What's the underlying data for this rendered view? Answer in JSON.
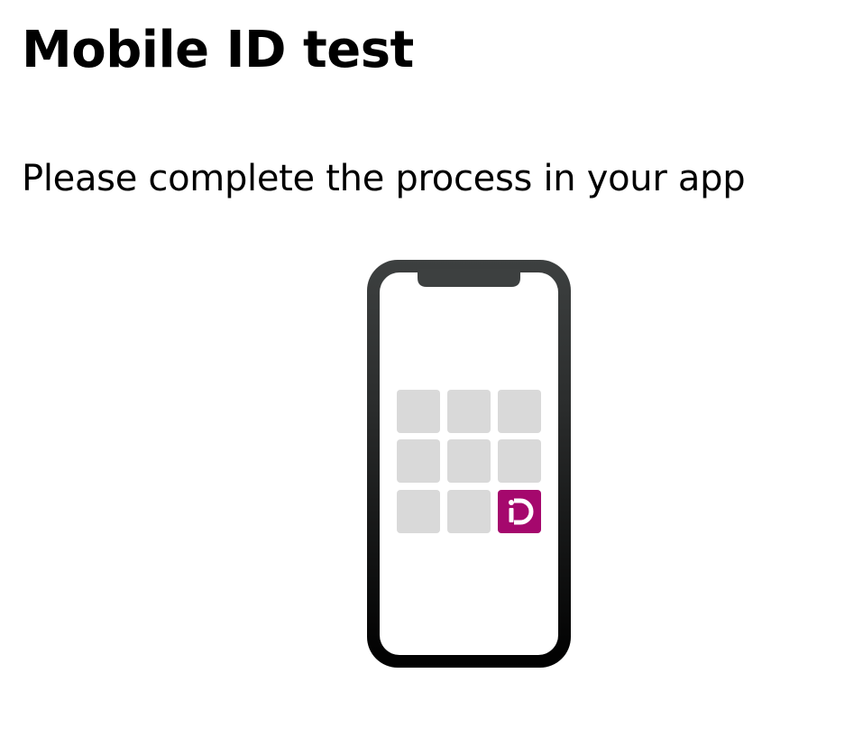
{
  "header": {
    "title": "Mobile ID test"
  },
  "main": {
    "instruction": "Please complete the process in your app"
  },
  "illustration": {
    "icon": "phone-icon",
    "app_icon": "mobile-id-app-icon",
    "app_color": "#a5086d",
    "tile_color": "#d9d9d9",
    "frame_color_top": "#3d4040",
    "frame_color_bottom": "#000000"
  }
}
